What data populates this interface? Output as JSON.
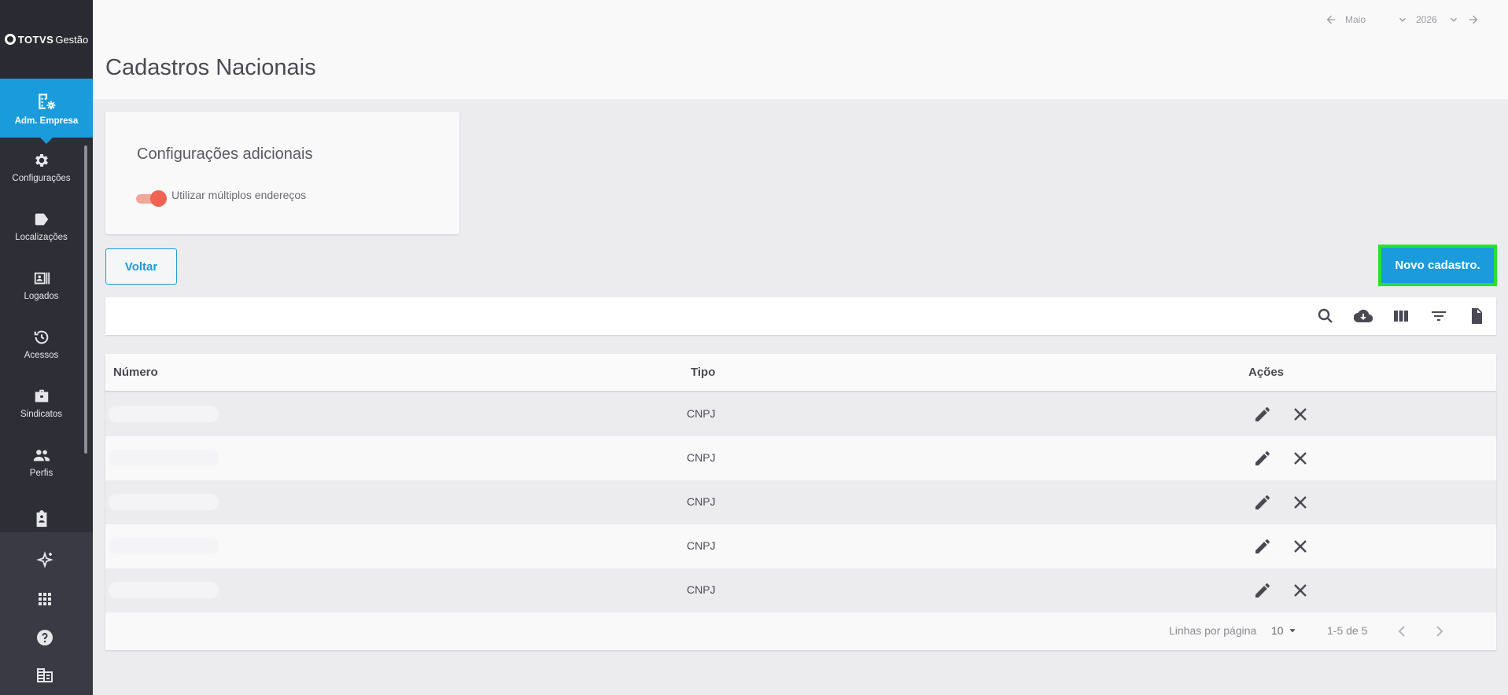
{
  "brand": {
    "bold": "TOTVS",
    "light": "Gestão"
  },
  "sidebar": {
    "active": {
      "label": "Adm. Empresa",
      "icon": "building-gear-icon"
    },
    "items": [
      {
        "label": "Configurações",
        "icon": "gear-icon"
      },
      {
        "label": "Localizações",
        "icon": "tag-icon"
      },
      {
        "label": "Logados",
        "icon": "badge-list-icon"
      },
      {
        "label": "Acessos",
        "icon": "history-icon"
      },
      {
        "label": "Sindicatos",
        "icon": "briefcase-icon"
      },
      {
        "label": "Perfis",
        "icon": "people-icon"
      },
      {
        "label": "",
        "icon": "clipboard-icon"
      }
    ],
    "bottom_icons": [
      "sparkle-icon",
      "apps-grid-icon",
      "help-icon",
      "company-icon"
    ]
  },
  "header": {
    "title": "Cadastros Nacionais",
    "period": {
      "month": "Maio",
      "year": "2026"
    }
  },
  "config_card": {
    "title": "Configurações adicionais",
    "toggle_label": "Utilizar múltiplos endereços",
    "toggle_on": true
  },
  "buttons": {
    "back": "Voltar",
    "new": "Novo cadastro."
  },
  "toolbar_icons": [
    "search-icon",
    "cloud-download-icon",
    "columns-icon",
    "filter-icon",
    "document-icon"
  ],
  "table": {
    "columns": [
      "Número",
      "Tipo",
      "Ações"
    ],
    "rows": [
      {
        "numero": "",
        "tipo": "CNPJ"
      },
      {
        "numero": "",
        "tipo": "CNPJ"
      },
      {
        "numero": "",
        "tipo": "CNPJ"
      },
      {
        "numero": "",
        "tipo": "CNPJ"
      },
      {
        "numero": "",
        "tipo": "CNPJ"
      }
    ],
    "footer": {
      "rows_per_page_label": "Linhas por página",
      "rows_per_page": "10",
      "range": "1-5 de 5"
    }
  },
  "colors": {
    "primary": "#1a9bdb",
    "sidebar": "#2e2e37",
    "toggle": "#ee6352",
    "highlight": "#27e22b"
  }
}
